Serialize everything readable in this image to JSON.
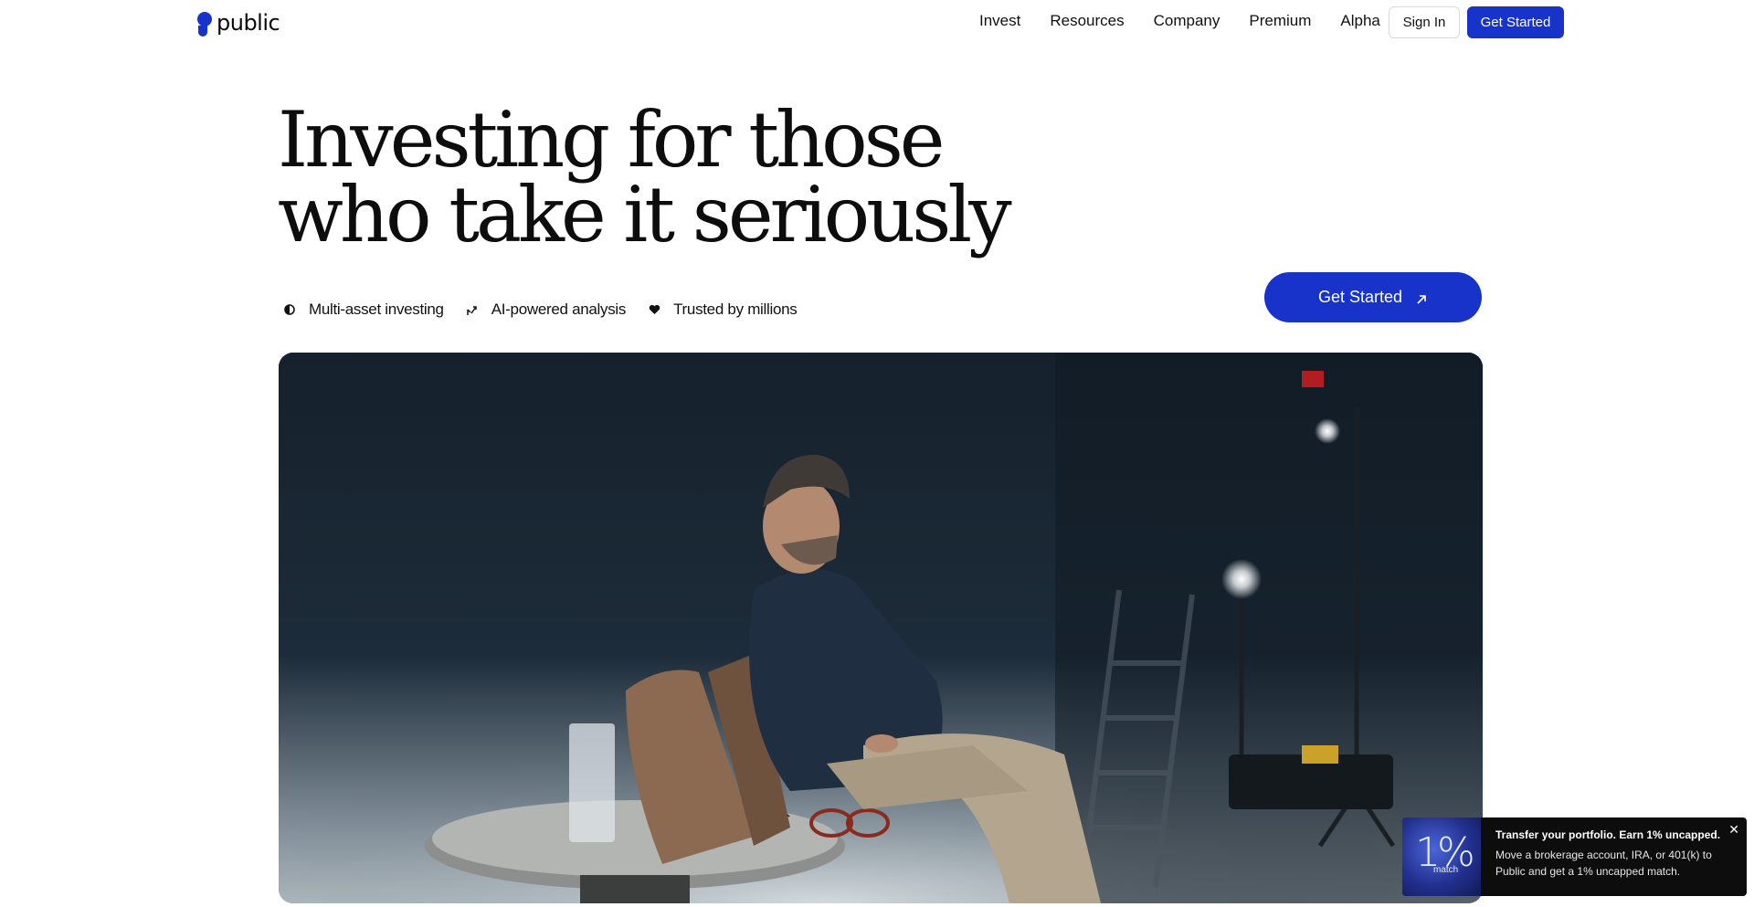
{
  "brand": {
    "name": "public",
    "color": "#1733c9"
  },
  "nav": {
    "links": [
      "Invest",
      "Resources",
      "Company",
      "Premium",
      "Alpha"
    ],
    "sign_in": "Sign In",
    "get_started": "Get Started"
  },
  "hero": {
    "title_line1": "Investing for those",
    "title_line2": "who take it seriously",
    "features": [
      {
        "icon": "half-circle-icon",
        "label": "Multi-asset investing"
      },
      {
        "icon": "trend-up-arrow-icon",
        "label": "AI-powered analysis"
      },
      {
        "icon": "heart-icon",
        "label": "Trusted by millions"
      }
    ],
    "cta": "Get Started",
    "cta_icon": "arrow-up-right-icon"
  },
  "video": {
    "description_icon": "video-still"
  },
  "toast": {
    "thumb_value": "1%",
    "thumb_caption": "match",
    "title": "Transfer your portfolio. Earn 1% uncapped.",
    "body": "Move a brokerage account, IRA, or 401(k) to Public and get a 1% uncapped match.",
    "close_icon": "close-icon",
    "close_glyph": "✕"
  }
}
